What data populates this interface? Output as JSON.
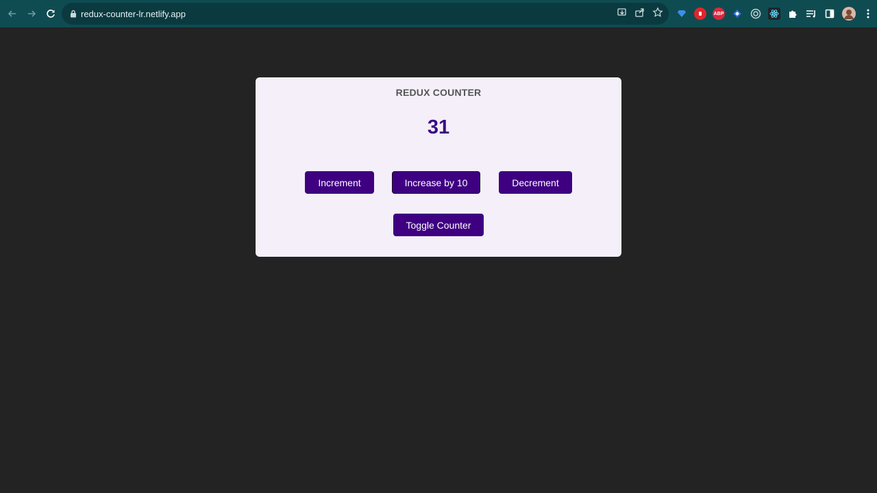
{
  "browser": {
    "url": "redux-counter-lr.netlify.app"
  },
  "extensions": [
    {
      "icon": "gem-extension-icon",
      "color": "#2a7de1"
    },
    {
      "icon": "hand-stop-extension-icon",
      "color": "#e0262b"
    },
    {
      "icon": "abp-extension-icon",
      "color": "#d8283e",
      "label": "ABP"
    },
    {
      "icon": "diamond-extension-icon",
      "color": "#2b6cd8"
    },
    {
      "icon": "target-extension-icon",
      "color": "#c9d2d4"
    },
    {
      "icon": "react-devtools-icon",
      "color": "#61dafb"
    },
    {
      "icon": "puzzle-extensions-icon",
      "color": "#ffffff"
    },
    {
      "icon": "reading-list-icon",
      "color": "#ffffff"
    },
    {
      "icon": "side-panel-icon",
      "color": "#ffffff"
    },
    {
      "icon": "profile-avatar",
      "color": "#d9b9a8"
    },
    {
      "icon": "kebab-menu-icon",
      "color": "#ffffff"
    }
  ],
  "app": {
    "title": "REDUX COUNTER",
    "counter": "31",
    "buttons": {
      "increment": "Increment",
      "increase_by_10": "Increase by 10",
      "decrement": "Decrement",
      "toggle": "Toggle Counter"
    },
    "colors": {
      "page_background": "#232323",
      "card_background": "#f4eff8",
      "button": "#3e0081",
      "counter_text": "#3b0a85"
    }
  }
}
